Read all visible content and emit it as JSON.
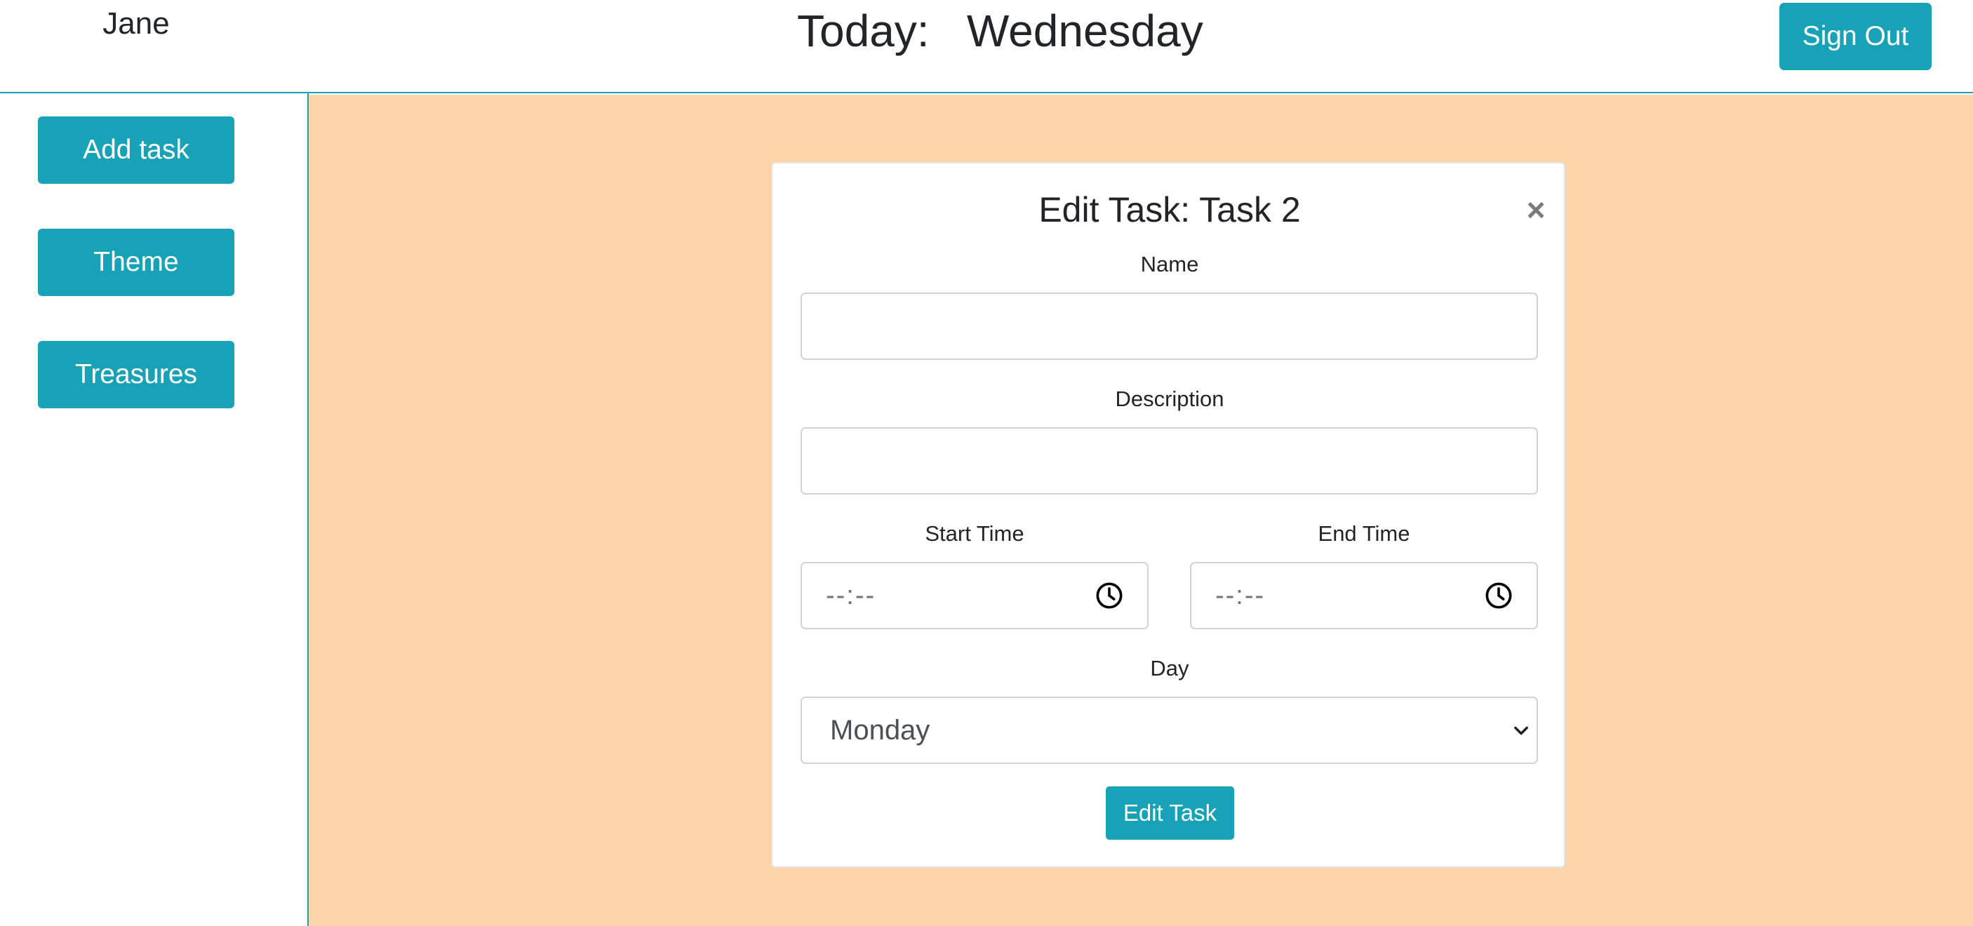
{
  "header": {
    "username": "Jane",
    "today_label": "Today:   Wednesday",
    "sign_out_label": "Sign Out"
  },
  "sidebar": {
    "items": [
      {
        "label": "Add task"
      },
      {
        "label": "Theme"
      },
      {
        "label": "Treasures"
      }
    ]
  },
  "modal": {
    "title": "Edit Task: Task 2",
    "close_glyph": "×",
    "name": {
      "label": "Name",
      "value": ""
    },
    "description": {
      "label": "Description",
      "value": ""
    },
    "start_time": {
      "label": "Start Time",
      "value": "--:--"
    },
    "end_time": {
      "label": "End Time",
      "value": "--:--"
    },
    "day": {
      "label": "Day",
      "selected": "Monday"
    },
    "submit_label": "Edit Task"
  },
  "colors": {
    "accent": "#17a2b8",
    "main_background": "#fdd5a8",
    "text": "#212529"
  },
  "icons": {
    "time_picker": "clock-icon",
    "select_dropdown": "chevron-down-icon",
    "modal_close": "close-icon"
  }
}
